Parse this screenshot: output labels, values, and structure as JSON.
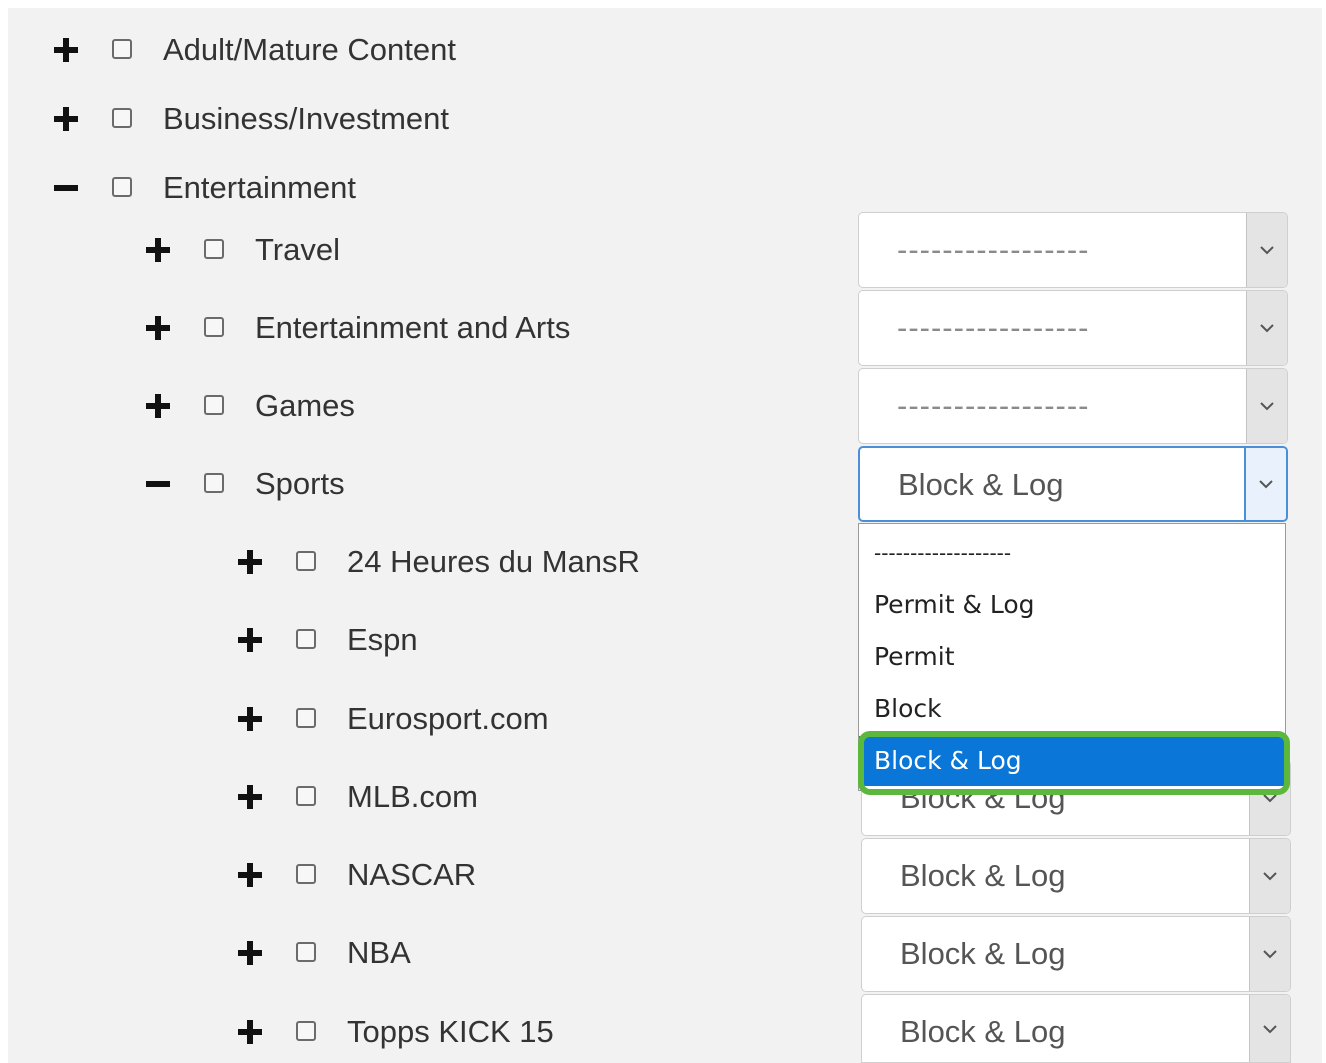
{
  "categories": [
    {
      "label": "Adult/Mature Content",
      "toggle": "+"
    },
    {
      "label": "Business/Investment",
      "toggle": "+"
    },
    {
      "label": "Entertainment",
      "toggle": "-"
    }
  ],
  "subcategories": [
    {
      "label": "Travel",
      "toggle": "+",
      "action": "-----------------"
    },
    {
      "label": "Entertainment and Arts",
      "toggle": "+",
      "action": "-----------------"
    },
    {
      "label": "Games",
      "toggle": "+",
      "action": "-----------------"
    },
    {
      "label": "Sports",
      "toggle": "-",
      "action": "Block & Log"
    }
  ],
  "sites": [
    {
      "label": "24 Heures du MansR",
      "toggle": "+"
    },
    {
      "label": "Espn",
      "toggle": "+"
    },
    {
      "label": "Eurosport.com",
      "toggle": "+"
    },
    {
      "label": "MLB.com",
      "toggle": "+",
      "action": "Block & Log"
    },
    {
      "label": "NASCAR",
      "toggle": "+",
      "action": "Block & Log"
    },
    {
      "label": "NBA",
      "toggle": "+",
      "action": "Block & Log"
    },
    {
      "label": "Topps KICK 15",
      "toggle": "+",
      "action": "Block & Log"
    }
  ],
  "dropdown": {
    "options": [
      "-------------------",
      "Permit & Log",
      "Permit",
      "Block",
      "Block & Log"
    ],
    "selected_index": 4
  },
  "colors": {
    "selected_option": "#0a76d8",
    "highlight_outline": "#5cb83c",
    "focus_border": "#4a90d9"
  }
}
